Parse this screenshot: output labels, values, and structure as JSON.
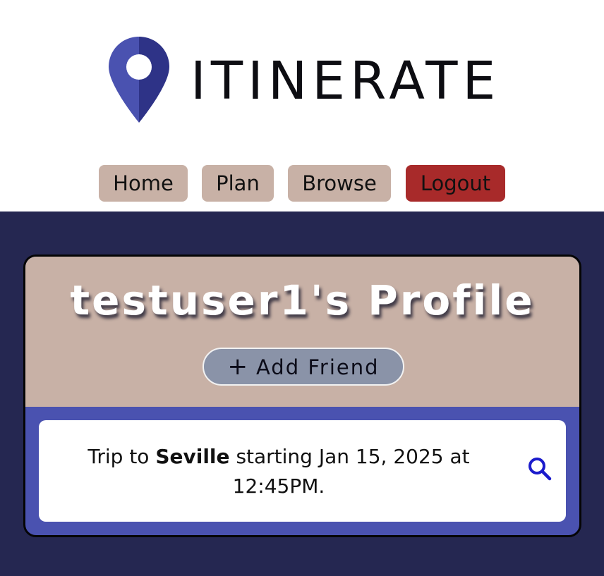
{
  "brand": {
    "name": "ITINERATE",
    "icon": "map-pin-icon",
    "pin_color_light": "#4a52b0",
    "pin_color_dark": "#2e3387"
  },
  "nav": {
    "items": [
      {
        "label": "Home"
      },
      {
        "label": "Plan"
      },
      {
        "label": "Browse"
      },
      {
        "label": "Logout"
      }
    ],
    "button_color": "#c8b1a6",
    "logout_color": "#a82a2a"
  },
  "profile": {
    "title": "testuser1's Profile",
    "add_friend_label": "Add Friend",
    "add_friend_icon": "plus-icon"
  },
  "trips": [
    {
      "prefix": "Trip to",
      "city": "Seville",
      "suffix": "starting Jan 15, 2025 at 12:45PM.",
      "action_icon": "search-icon"
    }
  ],
  "colors": {
    "background": "#252751",
    "card_accent": "#4a52b0",
    "card_head": "#c8b1a6"
  }
}
